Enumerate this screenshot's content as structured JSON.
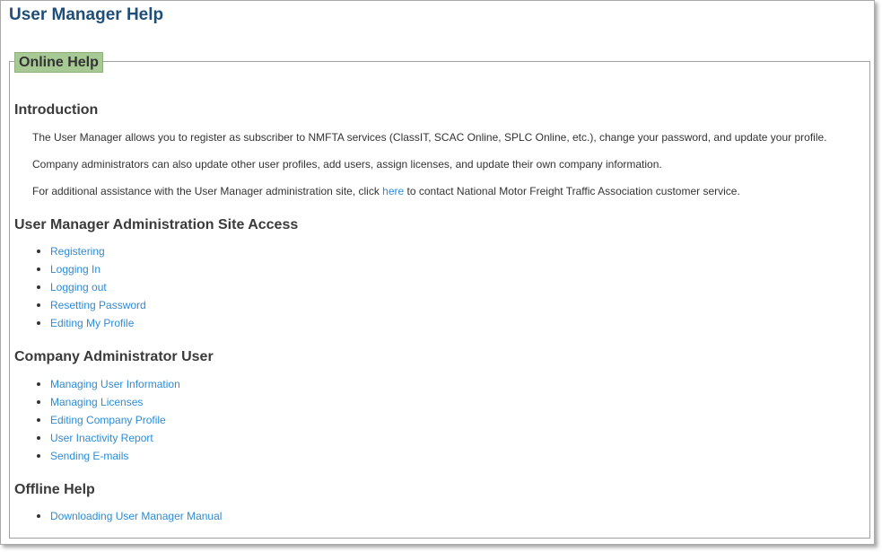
{
  "page": {
    "title": "User Manager Help"
  },
  "panel": {
    "legend": "Online Help"
  },
  "introduction": {
    "heading": "Introduction",
    "p1": "The User Manager allows you to register as subscriber to NMFTA services (ClassIT, SCAC Online, SPLC Online, etc.), change your password, and update your profile.",
    "p2": "Company administrators can also update other user profiles, add users, assign licenses, and update their own company information.",
    "p3_before": "For additional assistance with the User Manager administration site, click ",
    "p3_link": "here",
    "p3_after": " to contact National Motor Freight Traffic Association customer service."
  },
  "site_access": {
    "heading": "User Manager Administration Site Access",
    "links": [
      "Registering",
      "Logging In",
      "Logging out",
      "Resetting Password",
      "Editing My Profile"
    ]
  },
  "company_admin": {
    "heading": "Company Administrator User",
    "links": [
      "Managing User Information",
      "Managing Licenses",
      "Editing Company Profile",
      "User Inactivity Report",
      "Sending E-mails"
    ]
  },
  "offline_help": {
    "heading": "Offline Help",
    "links": [
      "Downloading User Manager Manual"
    ]
  },
  "colors": {
    "title": "#1f4e79",
    "legend_bg": "#a7c993",
    "link": "#2e8bd6"
  }
}
